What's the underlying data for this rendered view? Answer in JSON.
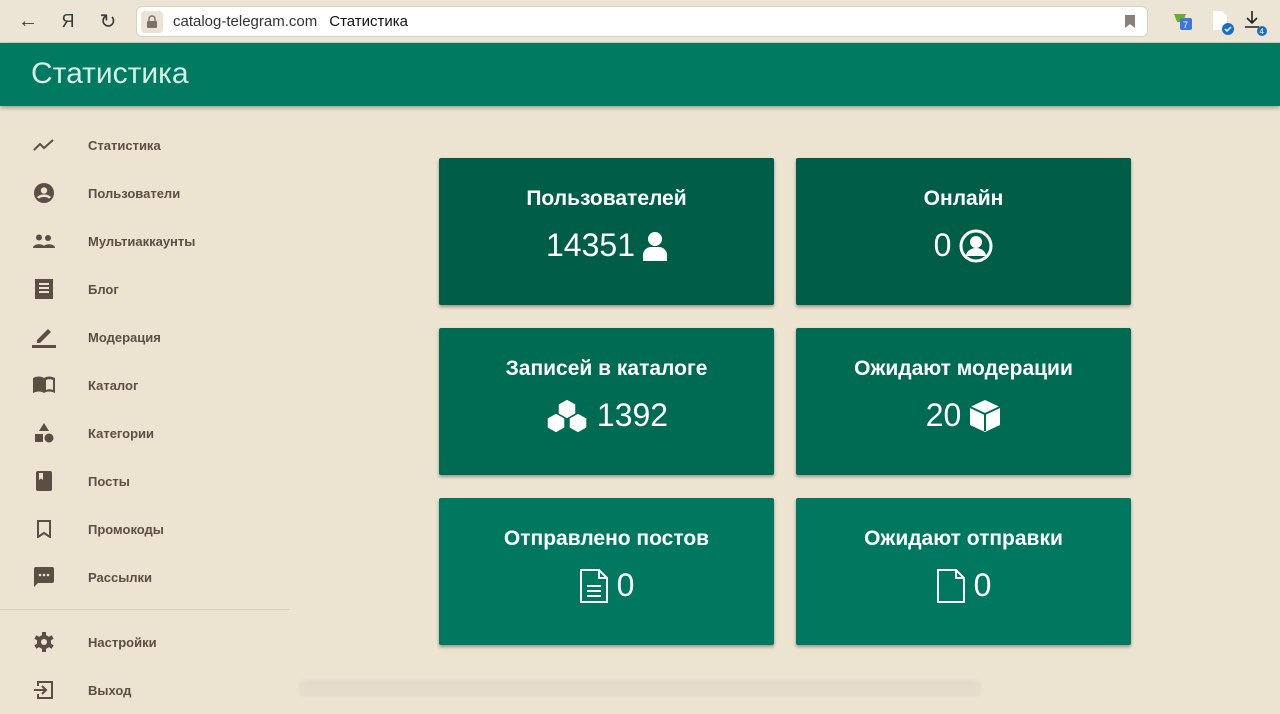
{
  "browser": {
    "url": "catalog-telegram.com",
    "page_title": "Статистика",
    "yandex_label": "Я",
    "ext_badge": "7",
    "downloads_badge": "4"
  },
  "app": {
    "title": "Статистика"
  },
  "sidebar": {
    "items": [
      {
        "label": "Статистика",
        "icon": "trending-icon"
      },
      {
        "label": "Пользователи",
        "icon": "account-circle-icon"
      },
      {
        "label": "Мультиаккаунты",
        "icon": "people-icon"
      },
      {
        "label": "Блог",
        "icon": "receipt-icon"
      },
      {
        "label": "Модерация",
        "icon": "edit-icon"
      },
      {
        "label": "Каталог",
        "icon": "book-open-icon"
      },
      {
        "label": "Категории",
        "icon": "category-icon"
      },
      {
        "label": "Посты",
        "icon": "book-icon"
      },
      {
        "label": "Промокоды",
        "icon": "bookmark-icon"
      },
      {
        "label": "Рассылки",
        "icon": "chat-icon"
      }
    ],
    "bottom": [
      {
        "label": "Настройки",
        "icon": "gear-icon"
      },
      {
        "label": "Выход",
        "icon": "logout-icon"
      }
    ]
  },
  "cards": [
    {
      "title": "Пользователей",
      "value": "14351",
      "icon": "user-icon"
    },
    {
      "title": "Онлайн",
      "value": "0",
      "icon": "user-circle-icon"
    },
    {
      "title": "Записей в каталоге",
      "value": "1392",
      "icon": "cubes-icon"
    },
    {
      "title": "Ожидают модерации",
      "value": "20",
      "icon": "cube-icon"
    },
    {
      "title": "Отправлено постов",
      "value": "0",
      "icon": "file-text-icon"
    },
    {
      "title": "Ожидают отправки",
      "value": "0",
      "icon": "file-icon"
    }
  ],
  "colors": {
    "header": "#007a60",
    "background": "#ede3d1",
    "row1": "#005e48",
    "row2": "#006b53",
    "row3": "#00785f"
  }
}
